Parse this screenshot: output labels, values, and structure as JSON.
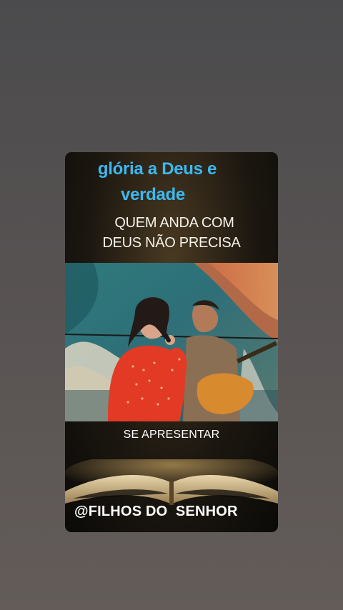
{
  "overlay": {
    "title_line1": "glória a Deus e",
    "title_line2": "verdade",
    "caption_line1": "QUEM ANDA COM",
    "caption_line2": "DEUS NÃO PRECISA",
    "caption_bottom": "SE APRESENTAR",
    "watermark": "@FILHOS DO  SENHOR"
  },
  "colors": {
    "title_blue": "#3db8f0",
    "dress_red": "#e23a25",
    "background": "#555050"
  }
}
